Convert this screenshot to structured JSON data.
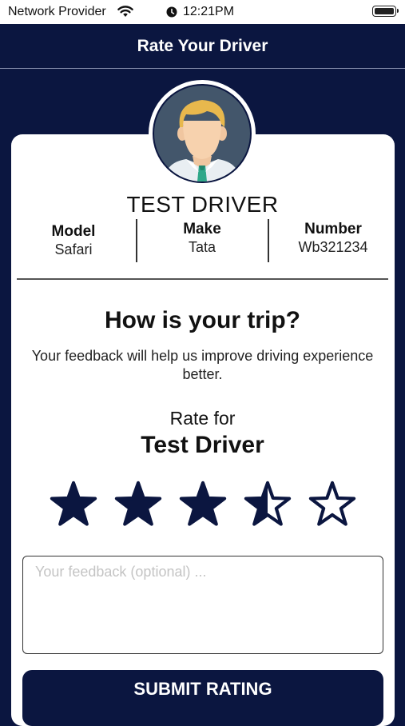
{
  "status_bar": {
    "carrier": "Network Provider",
    "time": "12:21PM"
  },
  "header": {
    "title": "Rate Your Driver"
  },
  "driver": {
    "name": "TEST DRIVER",
    "info": [
      {
        "label": "Model",
        "value": "Safari"
      },
      {
        "label": "Make",
        "value": "Tata"
      },
      {
        "label": "Number",
        "value": "Wb321234"
      }
    ]
  },
  "feedback": {
    "question": "How is your trip?",
    "hint": "Your feedback will help us improve driving experience better.",
    "rate_for": "Rate for",
    "rate_name": "Test Driver",
    "rating": 3.5,
    "max_rating": 5,
    "placeholder": "Your feedback (optional) ...",
    "submit_label": "SUBMIT RATING"
  },
  "colors": {
    "navy": "#0b1640",
    "card": "#ffffff",
    "avatar_bg": "#43566b"
  }
}
